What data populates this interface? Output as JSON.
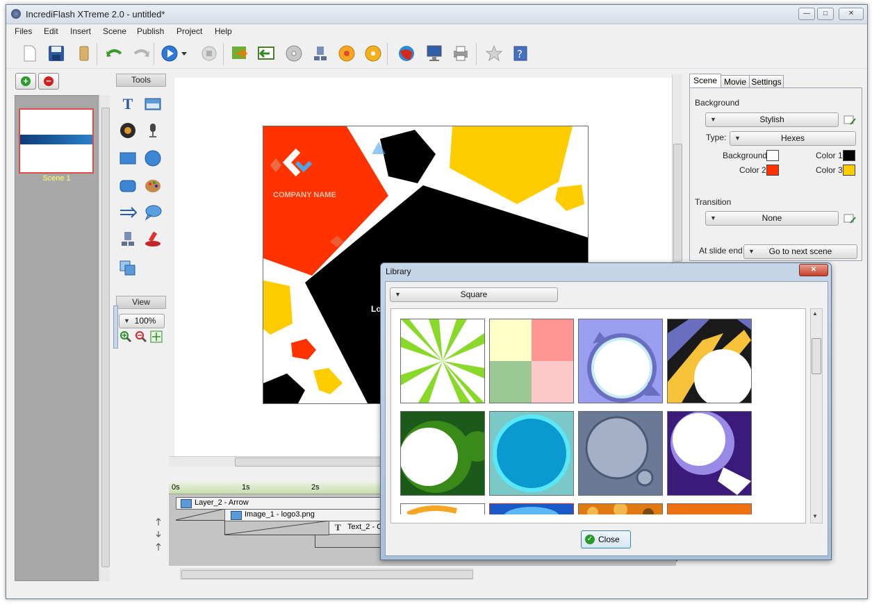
{
  "window": {
    "title": "IncrediFlash XTreme 2.0 - untitled*",
    "controls": {
      "minimize": "—",
      "maximize": "□",
      "close": "✕"
    }
  },
  "menu": [
    "Files",
    "Edit",
    "Insert",
    "Scene",
    "Publish",
    "Project",
    "Help"
  ],
  "toolbar": {
    "icons": [
      "new-file-icon",
      "save-icon",
      "open-folder-icon",
      "undo-icon",
      "redo-icon",
      "play-icon",
      "stop-icon",
      "import-icon",
      "export-icon",
      "cd-icon",
      "network-icon",
      "burn-disc-icon",
      "disc-icon",
      "globe-icon",
      "monitor-icon",
      "printer-icon",
      "star-icon",
      "help-icon"
    ]
  },
  "scenes": {
    "add": "+",
    "remove": "−",
    "items": [
      {
        "label": "Scene 1"
      }
    ]
  },
  "tools": {
    "header": "Tools",
    "text_glyph": "T"
  },
  "view": {
    "header": "View",
    "zoom": "100%"
  },
  "canvas": {
    "company": "COMPANY NAME",
    "lorem": "Lore"
  },
  "timeline": {
    "ruler": [
      "0s",
      "1s",
      "2s"
    ],
    "layers": [
      {
        "name": "Layer_2 - Arrow"
      },
      {
        "name": "Image_1 - logo3.png"
      },
      {
        "name": "Text_2 - C"
      }
    ],
    "text_glyph": "T"
  },
  "props": {
    "tabs": [
      "Scene",
      "Movie",
      "Settings"
    ],
    "background": {
      "label": "Background",
      "style": "Stylish",
      "type_label": "Type:",
      "type": "Hexes",
      "colors": [
        {
          "label": "Background",
          "hex": "#ffffff"
        },
        {
          "label": "Color 1",
          "hex": "#000000"
        },
        {
          "label": "Color 2",
          "hex": "#ff3300"
        },
        {
          "label": "Color 3",
          "hex": "#ffcc00"
        }
      ]
    },
    "transition": {
      "label": "Transition",
      "value": "None"
    },
    "slide_end": {
      "label": "At slide end:",
      "value": "Go to next scene"
    }
  },
  "library": {
    "title": "Library",
    "close_x": "✕",
    "filter": "Square",
    "close_label": "Close"
  },
  "colors": {
    "accent_red": "#ff3300",
    "accent_yellow": "#ffcc00",
    "scene_label": "#ffff66",
    "lib_border_sel": "#d03030"
  }
}
